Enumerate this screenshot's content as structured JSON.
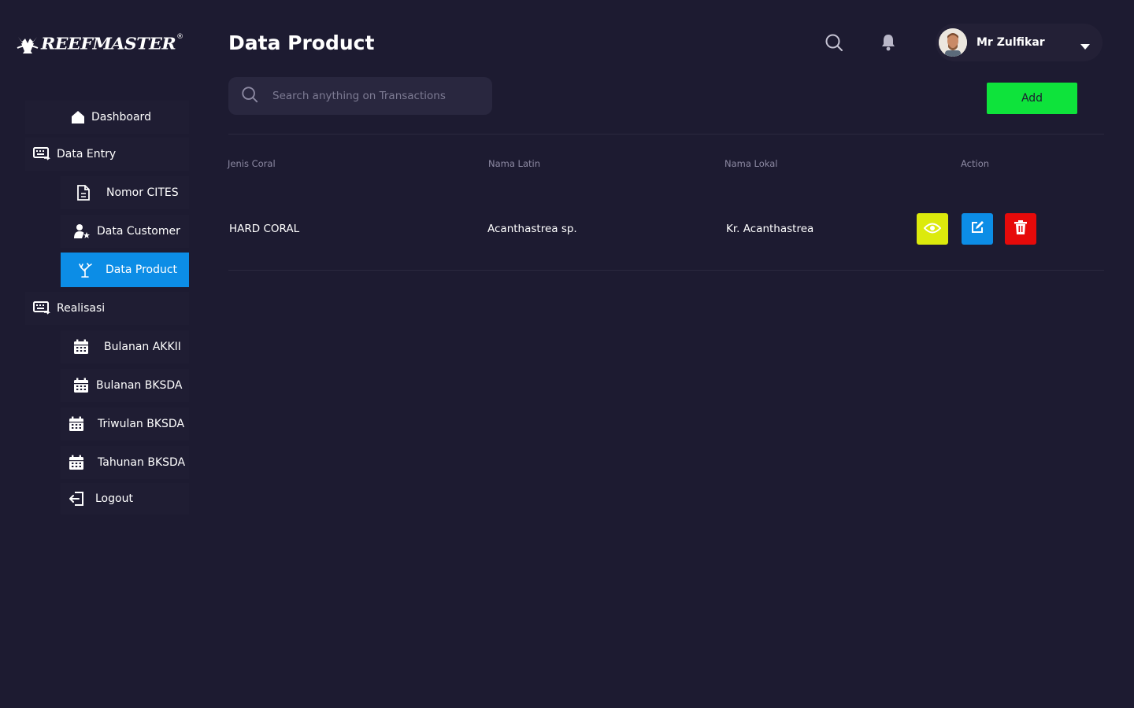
{
  "brand": {
    "name": "REEFMASTER",
    "registered_mark": "®"
  },
  "header": {
    "title": "Data Product",
    "search_icon": "search-icon",
    "notification_icon": "bell-icon",
    "user": {
      "name": "Mr Zulfikar",
      "avatar_icon": "avatar-image",
      "dropdown_icon": "caret-down-icon"
    }
  },
  "search": {
    "placeholder": "Search anything on Transactions",
    "value": ""
  },
  "toolbar": {
    "add_label": "Add",
    "add_color": "#0ee33b"
  },
  "sidebar": {
    "items": [
      {
        "label": "Dashboard",
        "icon": "home-icon"
      },
      {
        "label": "Data Entry",
        "icon": "keyboard-icon"
      },
      {
        "label": "Nomor CITES",
        "icon": "document-icon"
      },
      {
        "label": "Data Customer",
        "icon": "user-star-icon"
      },
      {
        "label": "Data Product",
        "icon": "coral-icon",
        "active": true
      },
      {
        "label": "Realisasi",
        "icon": "keyboard-icon"
      },
      {
        "label": "Bulanan AKKII",
        "icon": "calendar-icon"
      },
      {
        "label": "Bulanan BKSDA",
        "icon": "calendar-icon"
      },
      {
        "label": "Triwulan BKSDA",
        "icon": "calendar-icon"
      },
      {
        "label": "Tahunan BKSDA",
        "icon": "calendar-icon"
      },
      {
        "label": "Logout",
        "icon": "logout-icon"
      }
    ],
    "active_color": "#0c8de6"
  },
  "table": {
    "columns": [
      "Jenis Coral",
      "Nama Latin",
      "Nama Lokal",
      "Action"
    ],
    "rows": [
      {
        "jenis_coral": "HARD CORAL",
        "nama_latin": "Acanthastrea sp.",
        "nama_lokal": "Kr. Acanthastrea",
        "actions": [
          {
            "icon": "eye-icon",
            "color": "#dcea0c"
          },
          {
            "icon": "edit-icon",
            "color": "#0c8de6"
          },
          {
            "icon": "trash-icon",
            "color": "#e60a0a"
          }
        ]
      }
    ]
  },
  "theme": {
    "background": "#1d1b31"
  }
}
